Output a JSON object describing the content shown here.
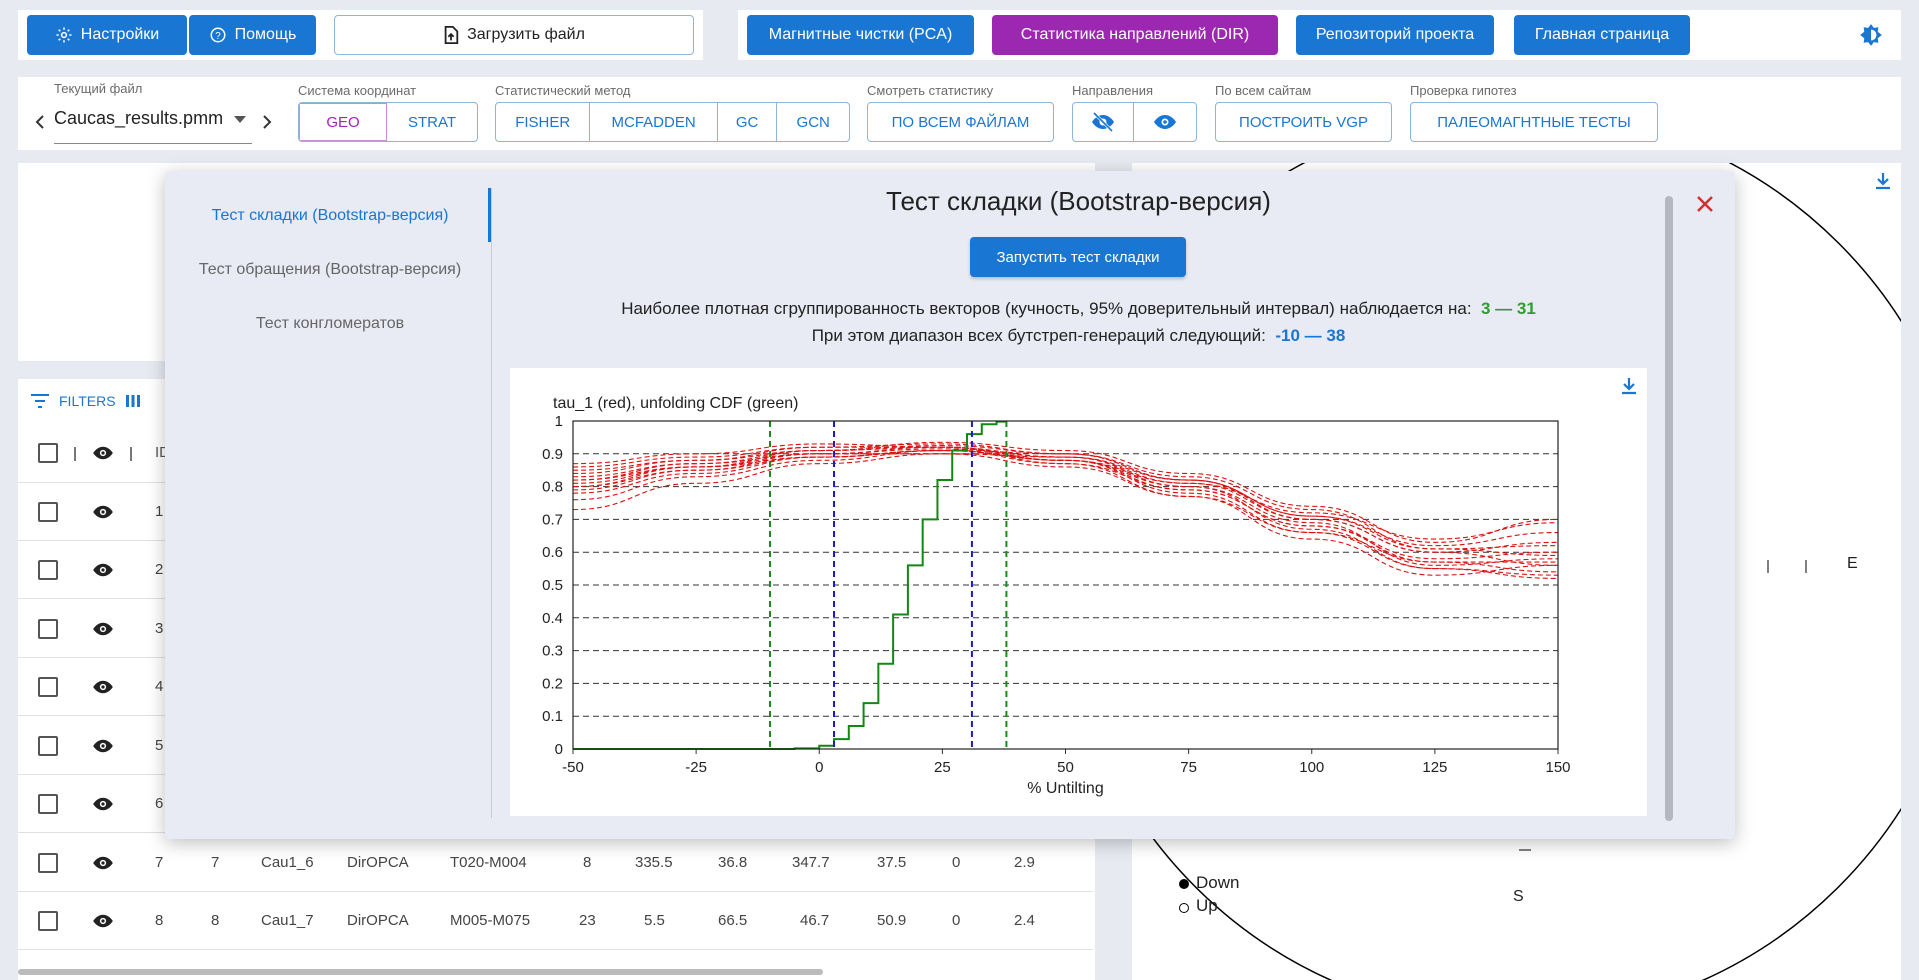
{
  "toolbar": {
    "settings": "Настройки",
    "help": "Помощь",
    "upload": "Загрузить файл",
    "pca": "Магнитные чистки (PCA)",
    "dir": "Статистика направлений (DIR)",
    "repo": "Репозиторий проекта",
    "home": "Главная страница"
  },
  "controls": {
    "current_file_label": "Текущий файл",
    "current_file": "Caucas_results.pmm",
    "coord_label": "Система координат",
    "coord": [
      "GEO",
      "STRAT"
    ],
    "method_label": "Статистический метод",
    "methods": [
      "FISHER",
      "MCFADDEN",
      "GC",
      "GCN"
    ],
    "stats_label": "Смотреть статистику",
    "stats_btn": "ПО ВСЕМ ФАЙЛАМ",
    "directions_label": "Направления",
    "sites_label": "По всем сайтам",
    "vgp_btn": "ПОСТРОИТЬ VGP",
    "hyp_label": "Проверка гипотез",
    "tests_btn": "ПАЛЕОМАГНТНЫЕ ТЕСТЫ"
  },
  "table": {
    "filters": "FILTERS",
    "header_id": "ID",
    "rows": [
      {
        "n": "1"
      },
      {
        "n": "2"
      },
      {
        "n": "3"
      },
      {
        "n": "4"
      },
      {
        "n": "5"
      },
      {
        "n": "6"
      },
      {
        "n": "7",
        "id": "7",
        "name": "Cau1_6",
        "code": "DirOPCA",
        "steps": "T020-M004",
        "count": "8",
        "a": "335.5",
        "b": "36.8",
        "c": "347.7",
        "d": "37.5",
        "e": "0",
        "f": "2.9"
      },
      {
        "n": "8",
        "id": "8",
        "name": "Cau1_7",
        "code": "DirOPCA",
        "steps": "M005-M075",
        "count": "23",
        "a": "5.5",
        "b": "66.5",
        "c": "46.7",
        "d": "50.9",
        "e": "0",
        "f": "2.4"
      }
    ]
  },
  "stereo": {
    "east": "E",
    "south": "S",
    "legend_down": "Down",
    "legend_up": "Up"
  },
  "modal": {
    "tabs": [
      "Тест складки (Bootstrap-версия)",
      "Тест обращения (Bootstrap-версия)",
      "Тест конгломератов"
    ],
    "title": "Тест складки (Bootstrap-версия)",
    "run_btn": "Запустить тест складки",
    "line1": "Наиболее плотная сгруппированность векторов (кучность, 95% доверительный интервал) наблюдается на:",
    "line1_value": "3 — 31",
    "line2": "При этом диапазон всех бутстреп-генераций следующий:",
    "line2_value": "-10 — 38"
  },
  "chart_data": {
    "type": "line",
    "title": "tau_1 (red), unfolding CDF (green)",
    "xlabel": "% Untilting",
    "ylabel": "",
    "xlim": [
      -50,
      150
    ],
    "ylim": [
      0,
      1
    ],
    "x_ticks": [
      "-50",
      "-25",
      "0",
      "25",
      "50",
      "75",
      "100",
      "125",
      "150"
    ],
    "y_ticks": [
      "0",
      "0.1",
      "0.2",
      "0.3",
      "0.4",
      "0.5",
      "0.6",
      "0.7",
      "0.8",
      "0.9",
      "1"
    ],
    "grid": true,
    "vlines_green": [
      -10,
      38
    ],
    "vlines_blue": [
      3,
      31
    ],
    "series": [
      {
        "color": "#dd1111",
        "style": "dashed",
        "x": [
          -50,
          -25,
          0,
          25,
          50,
          75,
          100,
          125,
          150
        ],
        "y": [
          0.82,
          0.87,
          0.91,
          0.92,
          0.88,
          0.79,
          0.68,
          0.58,
          0.6
        ]
      },
      {
        "color": "#dd1111",
        "style": "dashed",
        "x": [
          -50,
          -25,
          0,
          25,
          50,
          75,
          100,
          125,
          150
        ],
        "y": [
          0.8,
          0.86,
          0.9,
          0.915,
          0.89,
          0.81,
          0.7,
          0.6,
          0.56
        ]
      },
      {
        "color": "#dd1111",
        "style": "dashed",
        "x": [
          -50,
          -25,
          0,
          25,
          50,
          75,
          100,
          125,
          150
        ],
        "y": [
          0.84,
          0.88,
          0.92,
          0.93,
          0.9,
          0.82,
          0.7,
          0.6,
          0.63
        ]
      },
      {
        "color": "#dd1111",
        "style": "dashed",
        "x": [
          -50,
          -25,
          0,
          25,
          50,
          75,
          100,
          125,
          150
        ],
        "y": [
          0.78,
          0.84,
          0.89,
          0.91,
          0.88,
          0.8,
          0.69,
          0.56,
          0.58
        ]
      },
      {
        "color": "#dd1111",
        "style": "dashed",
        "x": [
          -50,
          -25,
          0,
          25,
          50,
          75,
          100,
          125,
          150
        ],
        "y": [
          0.86,
          0.89,
          0.92,
          0.92,
          0.88,
          0.78,
          0.66,
          0.57,
          0.54
        ]
      },
      {
        "color": "#dd1111",
        "style": "dashed",
        "x": [
          -50,
          -25,
          0,
          25,
          50,
          75,
          100,
          125,
          150
        ],
        "y": [
          0.76,
          0.83,
          0.88,
          0.91,
          0.9,
          0.83,
          0.73,
          0.61,
          0.59
        ]
      },
      {
        "color": "#dd1111",
        "style": "dashed",
        "x": [
          -50,
          -25,
          0,
          25,
          50,
          75,
          100,
          125,
          150
        ],
        "y": [
          0.83,
          0.87,
          0.9,
          0.9,
          0.86,
          0.77,
          0.66,
          0.55,
          0.52
        ]
      },
      {
        "color": "#dd1111",
        "style": "dashed",
        "x": [
          -50,
          -25,
          0,
          25,
          50,
          75,
          100,
          125,
          150
        ],
        "y": [
          0.81,
          0.86,
          0.91,
          0.935,
          0.91,
          0.84,
          0.74,
          0.63,
          0.7
        ]
      },
      {
        "color": "#dd1111",
        "style": "dashed",
        "x": [
          -50,
          -25,
          0,
          25,
          50,
          75,
          100,
          125,
          150
        ],
        "y": [
          0.73,
          0.81,
          0.87,
          0.9,
          0.89,
          0.82,
          0.71,
          0.61,
          0.62
        ]
      },
      {
        "color": "#dd1111",
        "style": "dashed",
        "x": [
          -50,
          -25,
          0,
          25,
          50,
          75,
          100,
          125,
          150
        ],
        "y": [
          0.87,
          0.9,
          0.93,
          0.92,
          0.87,
          0.77,
          0.64,
          0.53,
          0.56
        ]
      },
      {
        "color": "#dd1111",
        "style": "dashed",
        "x": [
          -50,
          -25,
          0,
          25,
          50,
          75,
          100,
          125,
          150
        ],
        "y": [
          0.79,
          0.85,
          0.89,
          0.91,
          0.87,
          0.79,
          0.68,
          0.57,
          0.57
        ]
      },
      {
        "color": "#dd1111",
        "style": "dashed",
        "x": [
          -50,
          -25,
          0,
          25,
          50,
          75,
          100,
          125,
          150
        ],
        "y": [
          0.85,
          0.88,
          0.91,
          0.925,
          0.9,
          0.82,
          0.71,
          0.62,
          0.66
        ]
      },
      {
        "color": "#dd1111",
        "style": "dashed",
        "x": [
          -50,
          -25,
          0,
          25,
          50,
          75,
          100,
          125,
          150
        ],
        "y": [
          0.8,
          0.85,
          0.9,
          0.92,
          0.89,
          0.8,
          0.67,
          0.55,
          0.53
        ]
      },
      {
        "color": "#dd1111",
        "style": "dashed",
        "x": [
          -50,
          -25,
          0,
          25,
          50,
          75,
          100,
          125,
          150
        ],
        "y": [
          0.82,
          0.86,
          0.89,
          0.91,
          0.88,
          0.81,
          0.72,
          0.64,
          0.69
        ]
      },
      {
        "color": "#118811",
        "style": "solid",
        "step": true,
        "x": [
          -10,
          -5,
          0,
          3,
          6,
          9,
          12,
          15,
          18,
          21,
          24,
          27,
          30,
          33,
          36,
          38
        ],
        "y": [
          0,
          0.002,
          0.01,
          0.03,
          0.07,
          0.14,
          0.26,
          0.41,
          0.56,
          0.7,
          0.82,
          0.91,
          0.96,
          0.99,
          0.998,
          1
        ]
      }
    ]
  }
}
